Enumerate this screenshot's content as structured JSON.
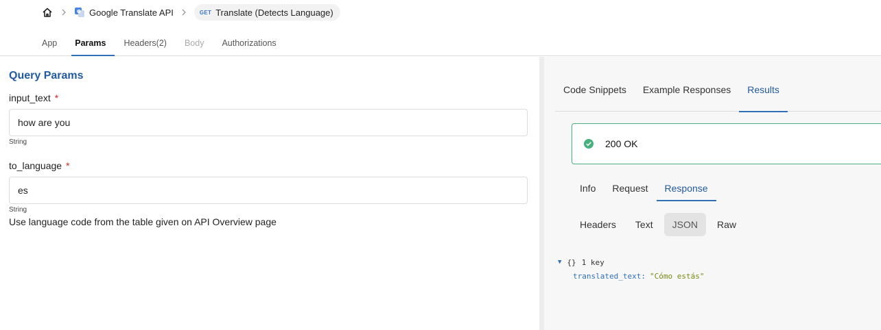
{
  "breadcrumb": {
    "app_name": "Google Translate API",
    "method": "GET",
    "endpoint": "Translate (Detects Language)"
  },
  "main_tabs": [
    {
      "label": "App"
    },
    {
      "label": "Params"
    },
    {
      "label": "Headers(2)"
    },
    {
      "label": "Body"
    },
    {
      "label": "Authorizations"
    }
  ],
  "params": {
    "section_title": "Query Params",
    "fields": [
      {
        "label": "input_text",
        "required": "*",
        "value": "how are you",
        "type": "String"
      },
      {
        "label": "to_language",
        "required": "*",
        "value": "es",
        "type": "String",
        "help": "Use language code from the table given on API Overview page"
      }
    ]
  },
  "right_tabs": [
    {
      "label": "Code Snippets"
    },
    {
      "label": "Example Responses"
    },
    {
      "label": "Results"
    }
  ],
  "status": {
    "text": "200 OK",
    "color": "#47b07f"
  },
  "sub_tabs": [
    {
      "label": "Info"
    },
    {
      "label": "Request"
    },
    {
      "label": "Response"
    }
  ],
  "format_tabs": [
    {
      "label": "Headers"
    },
    {
      "label": "Text"
    },
    {
      "label": "JSON"
    },
    {
      "label": "Raw"
    }
  ],
  "json_view": {
    "caret": "▼",
    "brace": "{}",
    "count": "1 key",
    "key": "translated_text:",
    "value": "\"Cómo estás\""
  },
  "colors": {
    "accent": "#2f6fb7",
    "title": "#215a9e",
    "required": "#d22222"
  }
}
